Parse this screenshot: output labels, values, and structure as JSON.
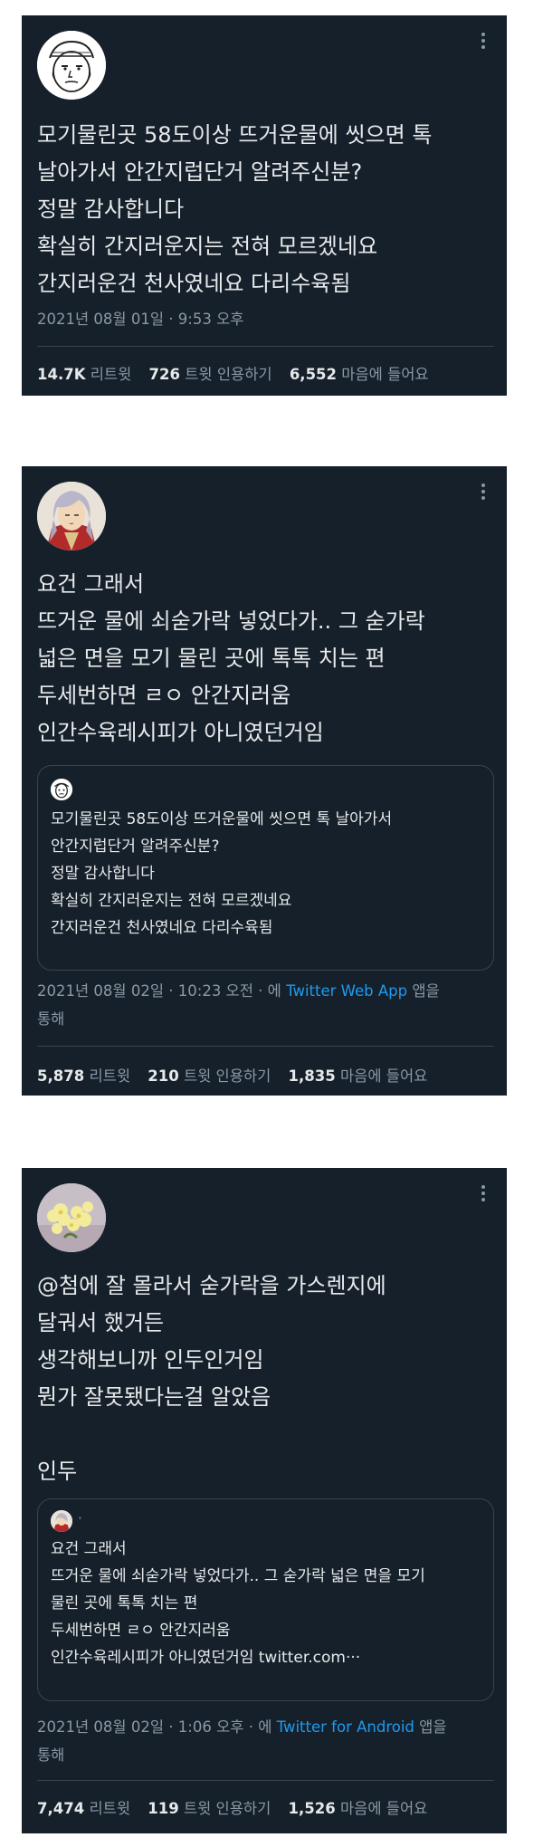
{
  "tweets": [
    {
      "lines": [
        "모기물린곳 58도이상 뜨거운물에 씻으면 톡",
        "날아가서 안간지럽단거 알려주신분?",
        "정말 감사합니다",
        "확실히 간지러운지는 전혀 모르겠네요",
        "간지러운건 천사였네요 다리수육됨"
      ],
      "date": "2021년 08월 01일",
      "time": "9:53 오후",
      "retweets": "14.7K",
      "retweets_label": "리트윗",
      "quotes": "726",
      "quotes_label": "트윗 인용하기",
      "likes": "6,552",
      "likes_label": "마음에 들어요"
    },
    {
      "lines": [
        "요건 그래서",
        "뜨거운 물에 쇠숟가락 넣었다가.. 그 숟가락",
        "넓은 면을 모기 물린 곳에 톡톡 치는 편",
        "두세번하면 ㄹㅇ 안간지러움",
        "인간수육레시피가 아니였던거임"
      ],
      "quote_lines": [
        "모기물린곳 58도이상 뜨거운물에 씻으면 톡 날아가서",
        "안간지럽단거 알려주신분?",
        "정말 감사합니다",
        "확실히 간지러운지는 전혀 모르겠네요",
        "간지러운건 천사였네요 다리수육됨"
      ],
      "date": "2021년 08월 02일",
      "time": "10:23 오전",
      "via_prefix": "에",
      "app": "Twitter Web App",
      "via_suffix": "앱을",
      "via_line2": "통해",
      "retweets": "5,878",
      "retweets_label": "리트윗",
      "quotes": "210",
      "quotes_label": "트윗 인용하기",
      "likes": "1,835",
      "likes_label": "마음에 들어요"
    },
    {
      "lines": [
        "@첨에 잘 몰라서 숟가락을 가스렌지에",
        "달궈서 했거든",
        "생각해보니까 인두인거임",
        "뭔가 잘못됐다는걸 알았음",
        "",
        "인두"
      ],
      "quote_name": "·",
      "quote_lines": [
        "요건 그래서",
        "뜨거운 물에 쇠숟가락 넣었다가.. 그 숟가락 넓은 면을 모기",
        "물린 곳에 톡톡 치는 편",
        "두세번하면 ㄹㅇ 안간지러움",
        "인간수육레시피가 아니였던거임 twitter.com···"
      ],
      "date": "2021년 08월 02일",
      "time": "1:06 오후",
      "via_prefix": "에",
      "app": "Twitter for Android",
      "via_suffix": "앱을",
      "via_line2": "통해",
      "retweets": "7,474",
      "retweets_label": "리트윗",
      "quotes": "119",
      "quotes_label": "트윗 인용하기",
      "likes": "1,526",
      "likes_label": "마음에 들어요"
    }
  ]
}
